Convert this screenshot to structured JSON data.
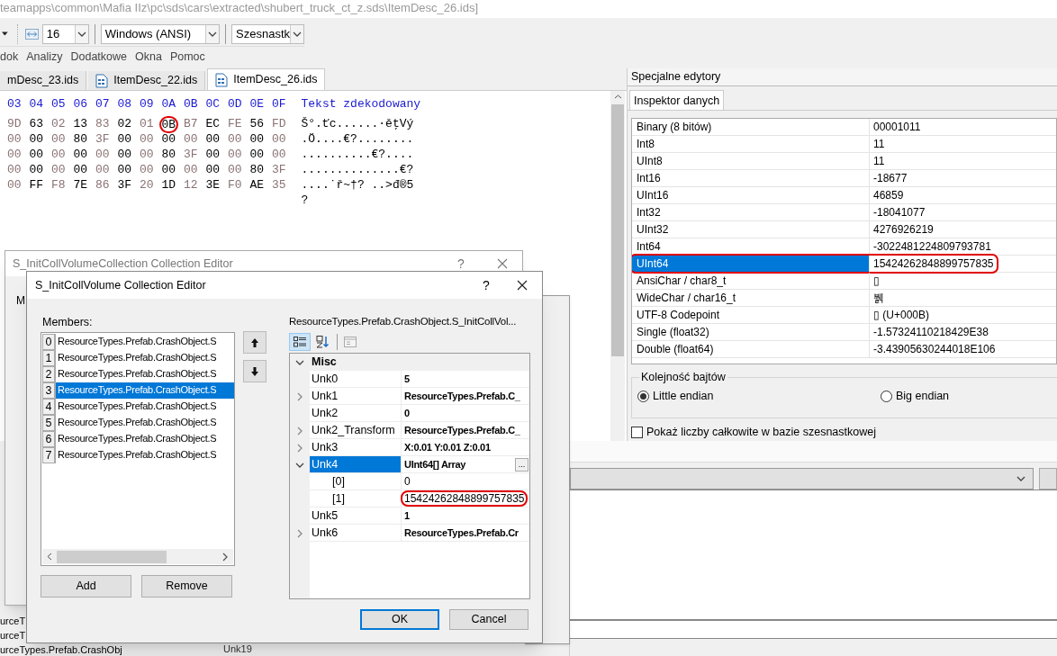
{
  "window": {
    "title_path": "teamapps\\common\\Mafia IIz\\pc\\sds\\cars\\extracted\\shubert_truck_ct_z.sds\\ItemDesc_26.ids]"
  },
  "toolbar": {
    "combos": [
      "16",
      "Windows (ANSI)",
      "Szesnastk"
    ]
  },
  "menu": [
    "dok",
    "Analizy",
    "Dodatkowe",
    "Okna",
    "Pomoc"
  ],
  "tabs": [
    {
      "label": "mDesc_23.ids",
      "selected": false
    },
    {
      "label": "ItemDesc_22.ids",
      "selected": false
    },
    {
      "label": "ItemDesc_26.ids",
      "selected": true
    }
  ],
  "hex": {
    "columns": [
      "03",
      "04",
      "05",
      "06",
      "07",
      "08",
      "09",
      "0A",
      "0B",
      "0C",
      "0D",
      "0E",
      "0F"
    ],
    "decoded_header": "Tekst zdekodowany",
    "rows": [
      {
        "bytes": [
          {
            "v": "9D",
            "circled": false
          },
          {
            "v": "63",
            "circled": false
          },
          {
            "v": "02",
            "circled": false
          },
          {
            "v": "13",
            "circled": false
          },
          {
            "v": "83",
            "circled": false
          },
          {
            "v": "02",
            "circled": false
          },
          {
            "v": "01",
            "circled": false
          },
          {
            "v": "0B",
            "circled": true
          },
          {
            "v": "B7",
            "circled": false
          },
          {
            "v": "EC",
            "circled": false
          },
          {
            "v": "FE",
            "circled": false
          },
          {
            "v": "56",
            "circled": false
          },
          {
            "v": "FD",
            "circled": false
          }
        ],
        "text": "Š°.ťc......·ěţVý"
      },
      {
        "bytes": [
          {
            "v": "00",
            "circled": false
          },
          {
            "v": "00",
            "circled": false
          },
          {
            "v": "00",
            "circled": false
          },
          {
            "v": "80",
            "circled": false
          },
          {
            "v": "3F",
            "circled": false
          },
          {
            "v": "00",
            "circled": false
          },
          {
            "v": "00",
            "circled": false
          },
          {
            "v": "00",
            "circled": false
          },
          {
            "v": "00",
            "circled": false
          },
          {
            "v": "00",
            "circled": false
          },
          {
            "v": "00",
            "circled": false
          },
          {
            "v": "00",
            "circled": false
          },
          {
            "v": "00",
            "circled": false
          }
        ],
        "text": ".Ö....€?........"
      },
      {
        "bytes": [
          {
            "v": "00",
            "circled": false
          },
          {
            "v": "00",
            "circled": false
          },
          {
            "v": "00",
            "circled": false
          },
          {
            "v": "00",
            "circled": false
          },
          {
            "v": "00",
            "circled": false
          },
          {
            "v": "00",
            "circled": false
          },
          {
            "v": "00",
            "circled": false
          },
          {
            "v": "80",
            "circled": false
          },
          {
            "v": "3F",
            "circled": false
          },
          {
            "v": "00",
            "circled": false
          },
          {
            "v": "00",
            "circled": false
          },
          {
            "v": "00",
            "circled": false
          },
          {
            "v": "00",
            "circled": false
          }
        ],
        "text": "..........€?...."
      },
      {
        "bytes": [
          {
            "v": "00",
            "circled": false
          },
          {
            "v": "00",
            "circled": false
          },
          {
            "v": "00",
            "circled": false
          },
          {
            "v": "00",
            "circled": false
          },
          {
            "v": "00",
            "circled": false
          },
          {
            "v": "00",
            "circled": false
          },
          {
            "v": "00",
            "circled": false
          },
          {
            "v": "00",
            "circled": false
          },
          {
            "v": "00",
            "circled": false
          },
          {
            "v": "00",
            "circled": false
          },
          {
            "v": "00",
            "circled": false
          },
          {
            "v": "80",
            "circled": false
          },
          {
            "v": "3F",
            "circled": false
          }
        ],
        "text": "..............€?"
      },
      {
        "bytes": [
          {
            "v": "00",
            "circled": false
          },
          {
            "v": "FF",
            "circled": false
          },
          {
            "v": "F8",
            "circled": false
          },
          {
            "v": "7E",
            "circled": false
          },
          {
            "v": "86",
            "circled": false
          },
          {
            "v": "3F",
            "circled": false
          },
          {
            "v": "20",
            "circled": false
          },
          {
            "v": "1D",
            "circled": false
          },
          {
            "v": "12",
            "circled": false
          },
          {
            "v": "3E",
            "circled": false
          },
          {
            "v": "F0",
            "circled": false
          },
          {
            "v": "AE",
            "circled": false
          },
          {
            "v": "35",
            "circled": false
          }
        ],
        "text": "....˙ř~†? ..>đ®5"
      },
      {
        "text": "?"
      }
    ]
  },
  "special_editors": {
    "title": "Specjalne edytory",
    "tabs": [
      {
        "label": "Inspektor danych",
        "selected": true
      }
    ],
    "rows": [
      {
        "name": "Binary (8 bitów)",
        "value": "00001011",
        "selected": false,
        "circled": false
      },
      {
        "name": "Int8",
        "value": "11",
        "selected": false,
        "circled": false
      },
      {
        "name": "UInt8",
        "value": "11",
        "selected": false,
        "circled": false
      },
      {
        "name": "Int16",
        "value": "-18677",
        "selected": false,
        "circled": false
      },
      {
        "name": "UInt16",
        "value": "46859",
        "selected": false,
        "circled": false
      },
      {
        "name": "Int32",
        "value": "-18041077",
        "selected": false,
        "circled": false
      },
      {
        "name": "UInt32",
        "value": "4276926219",
        "selected": false,
        "circled": false
      },
      {
        "name": "Int64",
        "value": "-3022481224809793781",
        "selected": false,
        "circled": false
      },
      {
        "name": "UInt64",
        "value": "15424262848899757835",
        "selected": true,
        "circled": true
      },
      {
        "name": "AnsiChar / char8_t",
        "value": "▯",
        "selected": false,
        "circled": false
      },
      {
        "name": "WideChar / char16_t",
        "value": "뷁",
        "selected": false,
        "circled": false
      },
      {
        "name": "UTF-8 Codepoint",
        "value": "▯ (U+000B)",
        "selected": false,
        "circled": false
      },
      {
        "name": "Single (float32)",
        "value": "-1.57324110218429E38",
        "selected": false,
        "circled": false
      },
      {
        "name": "Double (float64)",
        "value": "-3.43905630244018E106",
        "selected": false,
        "circled": false
      }
    ],
    "byte_order": {
      "title": "Kolejność bajtów",
      "options": [
        {
          "label": "Little endian",
          "selected": true
        },
        {
          "label": "Big endian",
          "selected": false
        }
      ]
    },
    "hex_checkbox": {
      "label": "Pokaż liczby całkowite w bazie szesnastkowej",
      "checked": false
    }
  },
  "background_fragments": {
    "left_lines": [
      "urceT",
      "urceT",
      "urceTypes.Prefab.CrashObj"
    ],
    "grid_label": "Unk19"
  },
  "back_dialog": {
    "title": "S_InitCollVolumeCollection Collection Editor",
    "help": "?",
    "members_label": "M"
  },
  "dialog": {
    "title": "S_InitCollVolume Collection Editor",
    "help": "?",
    "members_label": "Members:",
    "members": [
      {
        "index": "0",
        "label": "ResourceTypes.Prefab.CrashObject.S",
        "selected": false
      },
      {
        "index": "1",
        "label": "ResourceTypes.Prefab.CrashObject.S",
        "selected": false
      },
      {
        "index": "2",
        "label": "ResourceTypes.Prefab.CrashObject.S",
        "selected": false
      },
      {
        "index": "3",
        "label": "ResourceTypes.Prefab.CrashObject.S",
        "selected": true
      },
      {
        "index": "4",
        "label": "ResourceTypes.Prefab.CrashObject.S",
        "selected": false
      },
      {
        "index": "5",
        "label": "ResourceTypes.Prefab.CrashObject.S",
        "selected": false
      },
      {
        "index": "6",
        "label": "ResourceTypes.Prefab.CrashObject.S",
        "selected": false
      },
      {
        "index": "7",
        "label": "ResourceTypes.Prefab.CrashObject.S",
        "selected": false
      }
    ],
    "add_label": "Add",
    "remove_label": "Remove",
    "properties_title": "ResourceTypes.Prefab.CrashObject.S_InitCollVol...",
    "grid": [
      {
        "kind": "category",
        "name": "Misc",
        "expanded": true,
        "children": [
          {
            "kind": "property",
            "name": "Unk0",
            "value": "5",
            "selected": false,
            "circled": false
          },
          {
            "kind": "property",
            "name": "Unk1",
            "value": "ResourceTypes.Prefab.C_",
            "expanded": false,
            "selected": false,
            "circled": false
          },
          {
            "kind": "property",
            "name": "Unk2",
            "value": "0",
            "selected": false,
            "circled": false
          },
          {
            "kind": "property",
            "name": "Unk2_Transform",
            "value": "ResourceTypes.Prefab.C_",
            "expanded": false,
            "selected": false,
            "circled": false
          },
          {
            "kind": "property",
            "name": "Unk3",
            "value": "X:0.01 Y:0.01 Z:0.01",
            "expanded": false,
            "selected": false,
            "circled": false
          },
          {
            "kind": "property",
            "name": "Unk4",
            "value": "UInt64[] Array",
            "expanded": true,
            "selected": true,
            "circled": false,
            "edit_button": "...",
            "children": [
              {
                "kind": "element",
                "name": "[0]",
                "value": "0",
                "selected": false,
                "circled": false
              },
              {
                "kind": "element",
                "name": "[1]",
                "value": "15424262848899757835",
                "selected": false,
                "circled": true
              }
            ]
          },
          {
            "kind": "property",
            "name": "Unk5",
            "value": "1",
            "selected": false,
            "circled": false
          },
          {
            "kind": "property",
            "name": "Unk6",
            "value": "ResourceTypes.Prefab.Cr",
            "expanded": false,
            "selected": false,
            "circled": false
          }
        ]
      }
    ],
    "ok_label": "OK",
    "cancel_label": "Cancel"
  }
}
